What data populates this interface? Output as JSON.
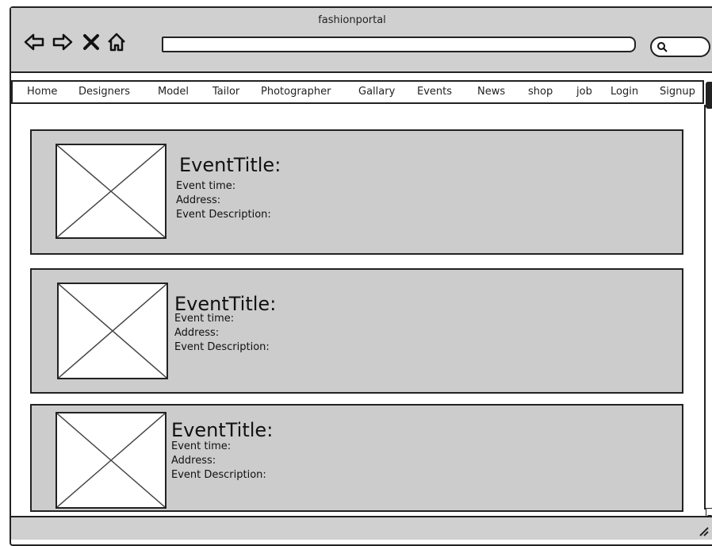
{
  "window": {
    "title": "fashionportal"
  },
  "toolbar": {
    "icons": [
      "back-arrow-icon",
      "forward-arrow-icon",
      "close-icon",
      "home-icon",
      "search-icon"
    ],
    "url_value": "",
    "search_value": ""
  },
  "menu": {
    "items": [
      {
        "label": "Home"
      },
      {
        "label": "Designers"
      },
      {
        "label": "Model"
      },
      {
        "label": "Tailor"
      },
      {
        "label": "Photographer"
      },
      {
        "label": "Gallary"
      },
      {
        "label": "Events"
      },
      {
        "label": "News"
      },
      {
        "label": "shop"
      },
      {
        "label": "job"
      },
      {
        "label": "Login"
      },
      {
        "label": "Signup"
      }
    ]
  },
  "events": [
    {
      "title": "EventTitle:",
      "time_label": "Event time:",
      "address_label": "Address:",
      "description_label": "Event Description:"
    },
    {
      "title": "EventTitle:",
      "time_label": "Event time:",
      "address_label": "Address:",
      "description_label": "Event Description:"
    },
    {
      "title": "EventTitle:",
      "time_label": "Event time:",
      "address_label": "Address:",
      "description_label": "Event Description:"
    }
  ],
  "colors": {
    "chrome": "#d0d0d0",
    "card": "#cccccc",
    "stroke": "#222222",
    "background": "#ffffff"
  }
}
